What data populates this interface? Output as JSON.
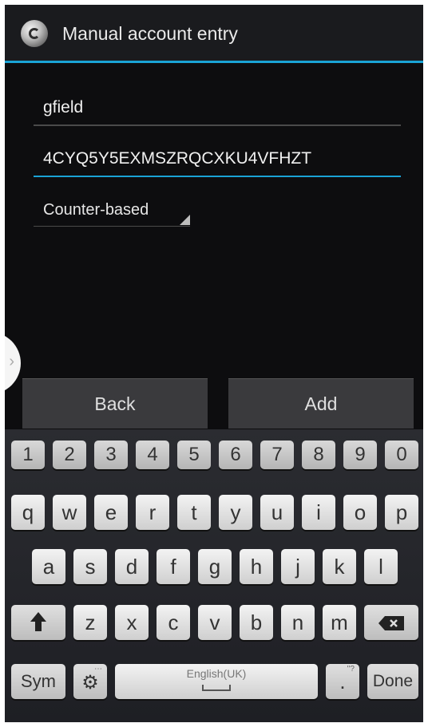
{
  "action_bar": {
    "title": "Manual account entry",
    "icon": "app-logo-icon"
  },
  "form": {
    "account_name": "gfield",
    "secret_key": "4CYQ5Y5EXMSZRQCXKU4VFHZT",
    "type_spinner": "Counter-based"
  },
  "buttons": {
    "back": "Back",
    "add": "Add"
  },
  "keyboard": {
    "numbers": [
      "1",
      "2",
      "3",
      "4",
      "5",
      "6",
      "7",
      "8",
      "9",
      "0"
    ],
    "row1": [
      "q",
      "w",
      "e",
      "r",
      "t",
      "y",
      "u",
      "i",
      "o",
      "p"
    ],
    "row2": [
      "a",
      "s",
      "d",
      "f",
      "g",
      "h",
      "j",
      "k",
      "l"
    ],
    "row3": [
      "z",
      "x",
      "c",
      "v",
      "b",
      "n",
      "m"
    ],
    "sym": "Sym",
    "space_label": "English(UK)",
    "period": ".",
    "done": "Done"
  },
  "colors": {
    "accent": "#1aa3d6",
    "background": "#0d0d0f"
  }
}
